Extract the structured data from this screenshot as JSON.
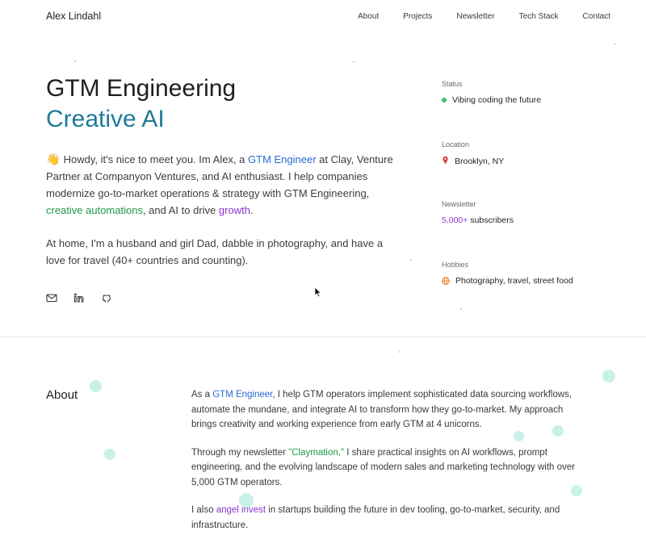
{
  "nav": {
    "brand": "Alex Lindahl",
    "links": [
      "About",
      "Projects",
      "Newsletter",
      "Tech Stack",
      "Contact"
    ]
  },
  "hero": {
    "title": "GTM Engineering",
    "subtitle": "Creative AI"
  },
  "intro": {
    "wave": "👋",
    "p1_a": " Howdy, it's nice to meet you. Im Alex, a ",
    "p1_link": "GTM Engineer",
    "p1_b": " at Clay, Venture Partner at Companyon Ventures, and AI enthusiast. I help companies modernize go-to-market operations & strategy with GTM Engineering, ",
    "p1_green": "creative automations",
    "p1_c": ", and AI to drive ",
    "p1_purple": "growth",
    "p1_d": ".",
    "p2": "At home, I'm a husband and girl Dad, dabble in photography, and have a love for travel (40+ countries and counting)."
  },
  "social": [
    "mail-icon",
    "linkedin-icon",
    "github-icon"
  ],
  "side": {
    "status_label": "Status",
    "status_value": "Vibing coding the future",
    "location_label": "Location",
    "location_value": "Brooklyn, NY",
    "newsletter_label": "Newsletter",
    "newsletter_count": "5,000+",
    "newsletter_suffix": " subscribers",
    "hobbies_label": "Hobbies",
    "hobbies_value": "Photography, travel, street food"
  },
  "about": {
    "heading": "About",
    "p1_a": "As a ",
    "p1_link": "GTM Engineer",
    "p1_b": ", I help GTM operators implement sophisticated data sourcing workflows, automate the mundane, and integrate AI to transform how they go-to-market. My approach brings creativity and working experience from early GTM at 4 unicorns.",
    "p2_a": "Through my newsletter ",
    "p2_link": "\"Claymation,\"",
    "p2_b": " I share practical insights on AI workflows, prompt engineering, and the evolving landscape of modern sales and marketing technology with over 5,000 GTM operators.",
    "p3_a": "I also ",
    "p3_link": "angel invest",
    "p3_b": " in startups building the future in dev tooling, go-to-market, security, and infrastructure."
  },
  "colors": {
    "accent_teal": "#1f7a99",
    "link_blue": "#2a6bd1",
    "link_green": "#1f9a4a",
    "link_purple": "#8a35cf",
    "status_green": "#3cc374"
  }
}
